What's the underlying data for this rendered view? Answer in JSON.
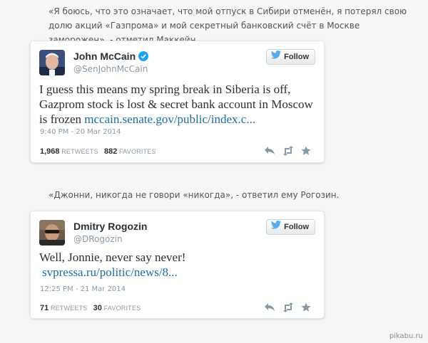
{
  "quote1": "«Я боюсь, что это означает, что мой отпуск в Сибири отменён, я потерял свою долю акций «Газпрома» и мой секретный банковский счёт в Москве заморожен», - отметил Маккейн.",
  "quote2": "«Джонни, никогда не говори «никогда», - ответил ему Рогозин.",
  "tweet1": {
    "name": "John McCain",
    "handle": "@SenJohnMcCain",
    "follow_label": "Follow",
    "text": "I guess this means my spring break in Siberia is off, Gazprom stock is lost & secret bank account in Moscow is frozen ",
    "link": "mccain.senate.gov/public/index.c...",
    "timestamp": "9:40 PM - 20 Mar 2014",
    "retweets": "1,968",
    "retweets_label": "RETWEETS",
    "favorites": "882",
    "favorites_label": "FAVORITES"
  },
  "tweet2": {
    "name": "Dmitry Rogozin",
    "handle": "@DRogozin",
    "follow_label": "Follow",
    "text": "Well, Jonnie, never say never!",
    "link": "svpressa.ru/politic/news/8...",
    "timestamp": "12:25 PM - 21 Mar 2014",
    "retweets": "71",
    "retweets_label": "RETWEETS",
    "favorites": "30",
    "favorites_label": "FAVORITES"
  },
  "watermark": "pikabu.ru",
  "colors": {
    "link": "#1a6fa5",
    "verified": "#1da1f2",
    "twitter_bird": "#55acee"
  }
}
